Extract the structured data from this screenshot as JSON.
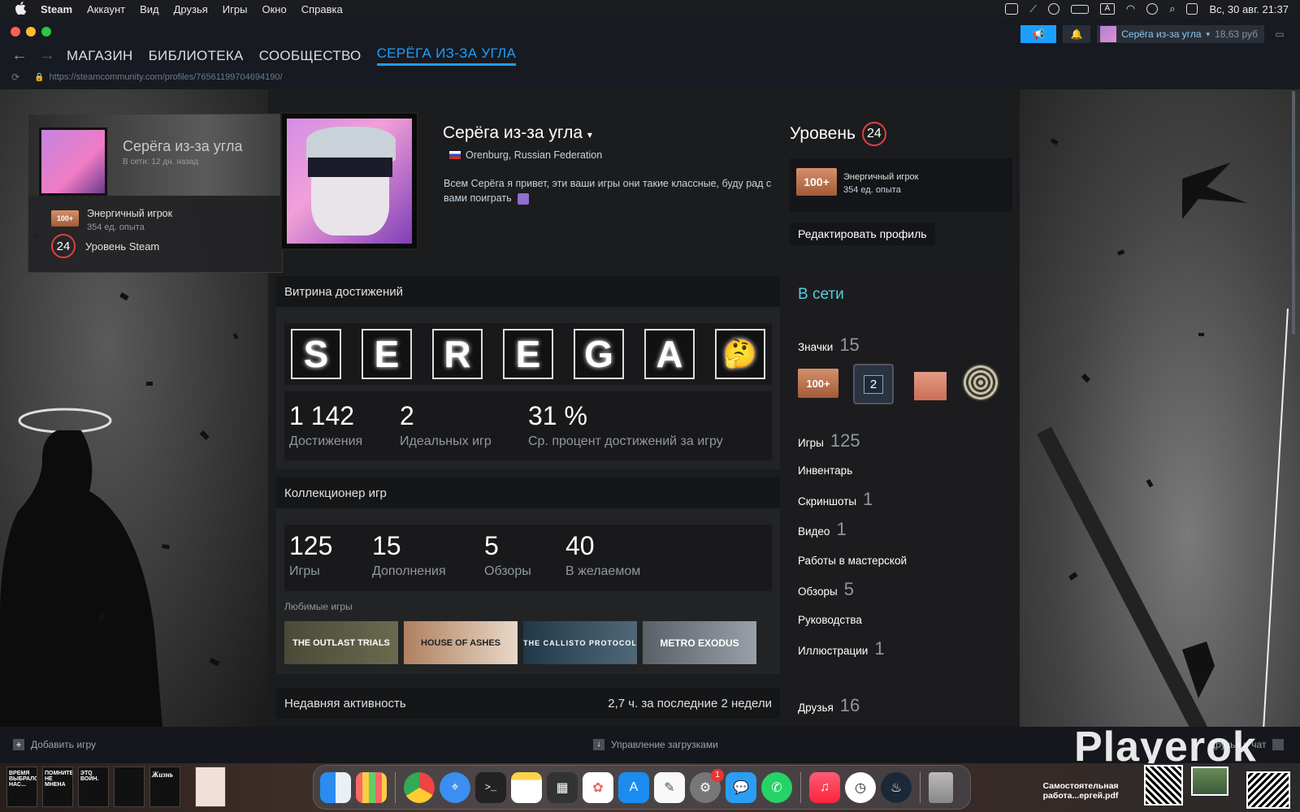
{
  "menubar": {
    "app": "Steam",
    "items": [
      "Аккаунт",
      "Вид",
      "Друзья",
      "Игры",
      "Окно",
      "Справка"
    ],
    "clock": "Вс, 30 авг.  21:37"
  },
  "chrome": {
    "nav": [
      "МАГАЗИН",
      "БИБЛИОТЕКА",
      "СООБЩЕСТВО",
      "СЕРЁГА ИЗ-ЗА УГЛА"
    ],
    "url": "https://steamcommunity.com/profiles/76561199704694190/",
    "account_name": "Серёга из-за угла",
    "balance": "18,63 руб"
  },
  "minicard": {
    "name": "Серёга из-за угла",
    "status": "В сети: 12 дн. назад",
    "badge_text": "100+",
    "badge_name": "Энергичный игрок",
    "badge_xp": "354 ед. опыта",
    "level": "24",
    "level_label": "Уровень Steam"
  },
  "profile": {
    "name": "Серёга из-за угла",
    "location": "Orenburg, Russian Federation",
    "summary": "Всем Серёга я привет, эти ваши игры они такие классные, буду рад с вами поиграть"
  },
  "level": {
    "label": "Уровень",
    "value": "24",
    "badge_text": "100+",
    "badge_name": "Энергичный игрок",
    "badge_xp": "354 ед. опыта",
    "edit_button": "Редактировать профиль"
  },
  "achievements": {
    "title": "Витрина достижений",
    "letters": [
      "S",
      "E",
      "R",
      "E",
      "G",
      "A",
      "🤔"
    ],
    "stats": [
      {
        "value": "1 142",
        "label": "Достижения"
      },
      {
        "value": "2",
        "label": "Идеальных игр"
      },
      {
        "value": "31 %",
        "label": "Ср. процент достижений за игру"
      }
    ]
  },
  "collector": {
    "title": "Коллекционер игр",
    "stats": [
      {
        "value": "125",
        "label": "Игры"
      },
      {
        "value": "15",
        "label": "Дополнения"
      },
      {
        "value": "5",
        "label": "Обзоры"
      },
      {
        "value": "40",
        "label": "В желаемом"
      }
    ],
    "fav_label": "Любимые игры",
    "games": [
      "THE OUTLAST TRIALS",
      "HOUSE OF ASHES",
      "THE CALLISTO PROTOCOL",
      "METRO EXODUS"
    ]
  },
  "recent": {
    "title": "Недавняя активность",
    "hours": "2,7 ч. за последние 2 недели"
  },
  "rightcol": {
    "status": "В сети",
    "badges_label": "Значки",
    "badges_count": "15",
    "badge_2": "2",
    "badge_100": "100+",
    "links": [
      {
        "label": "Игры",
        "count": "125"
      },
      {
        "label": "Инвентарь",
        "count": ""
      },
      {
        "label": "Скриншоты",
        "count": "1"
      },
      {
        "label": "Видео",
        "count": "1"
      },
      {
        "label": "Работы в мастерской",
        "count": ""
      },
      {
        "label": "Обзоры",
        "count": "5"
      },
      {
        "label": "Руководства",
        "count": ""
      },
      {
        "label": "Иллюстрации",
        "count": "1"
      }
    ],
    "friends_label": "Друзья",
    "friends_count": "16"
  },
  "bottombar": {
    "add_game": "Добавить игру",
    "downloads": "Управление загрузками",
    "chat": "Друзья и чат"
  },
  "watermark": "Playerok",
  "dock": {
    "thumb1": "ВРЕМЯ ВЫБРАЛО НАС...",
    "thumb2": "ПОМНИТЕ НЕ МНЕНА",
    "thumb3": "ЭТО ВОЙН.",
    "thumb5": "Жизнь",
    "pdf_label": "Самостоятельная работа...ергей.pdf",
    "settings_badge": "1"
  },
  "colors": {
    "accent": "#1a9fff",
    "online": "#57cbde",
    "level_ring": "#e04040"
  }
}
